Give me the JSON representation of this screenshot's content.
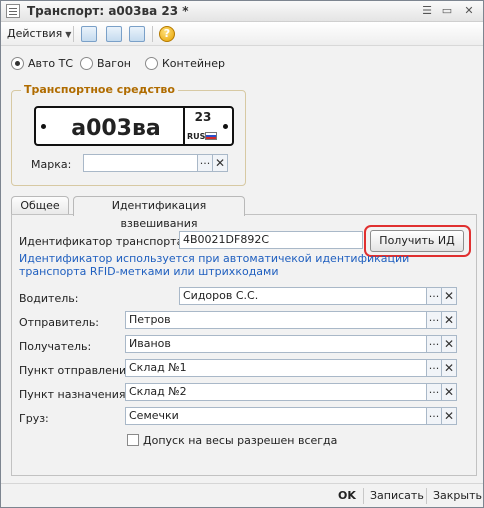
{
  "window": {
    "title": "Транспорт: а003ва 23 *",
    "controls": [
      "☰",
      "▭",
      "✕"
    ]
  },
  "toolbar": {
    "actions_label": "Действия",
    "help_symbol": "?"
  },
  "transport_types": [
    {
      "label": "Авто ТС",
      "selected": true
    },
    {
      "label": "Вагон",
      "selected": false
    },
    {
      "label": "Контейнер",
      "selected": false
    }
  ],
  "vehicle_group": {
    "title": "Транспортное средство",
    "plate_number": "а003ва",
    "plate_region": "23",
    "plate_country": "RUS",
    "brand_label": "Марка:",
    "brand_value": ""
  },
  "tabs": [
    {
      "label": "Общее",
      "active": false
    },
    {
      "label": "Идентификация взвешивания",
      "active": true
    }
  ],
  "identification": {
    "id_label": "Идентификатор транспорта:",
    "id_value": "4B0021DF892C",
    "get_id_button": "Получить ИД",
    "info_text": "Идентификатор используется при автоматичекой идентификации транспорта RFID-метками или штрихкодами"
  },
  "fields": {
    "driver_label": "Водитель:",
    "driver_value": "Сидоров С.С.",
    "sender_label": "Отправитель:",
    "sender_value": "Петров",
    "receiver_label": "Получатель:",
    "receiver_value": "Иванов",
    "departure_label": "Пункт отправления:",
    "departure_value": "Склад №1",
    "destination_label": "Пункт назначения:",
    "destination_value": "Склад №2",
    "cargo_label": "Груз:",
    "cargo_value": "Семечки"
  },
  "allow_always": {
    "label": "Допуск на весы разрешен всегда",
    "checked": false
  },
  "footer": {
    "ok": "OK",
    "save": "Записать",
    "close": "Закрыть"
  },
  "colors": {
    "group_title": "#b06c00",
    "info_link": "#1f5fbf",
    "highlight": "#e03030"
  }
}
